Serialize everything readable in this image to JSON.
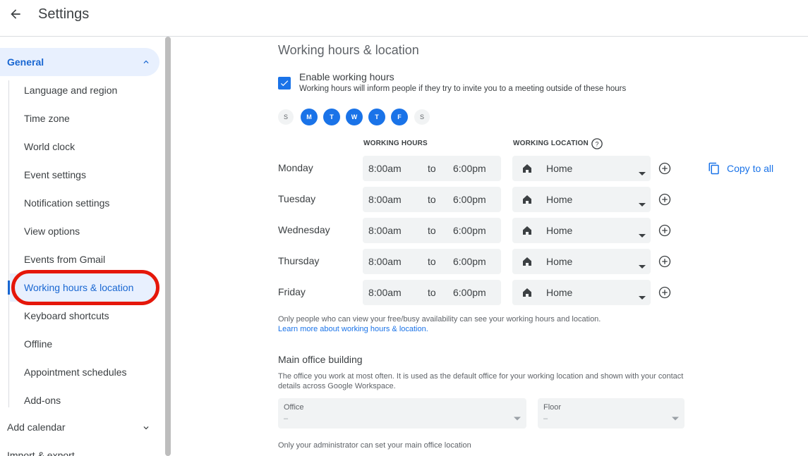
{
  "header": {
    "title": "Settings"
  },
  "sidebar": {
    "general_label": "General",
    "items": [
      {
        "label": "Language and region"
      },
      {
        "label": "Time zone"
      },
      {
        "label": "World clock"
      },
      {
        "label": "Event settings"
      },
      {
        "label": "Notification settings"
      },
      {
        "label": "View options"
      },
      {
        "label": "Events from Gmail"
      },
      {
        "label": "Working hours & location"
      },
      {
        "label": "Keyboard shortcuts"
      },
      {
        "label": "Offline"
      },
      {
        "label": "Appointment schedules"
      },
      {
        "label": "Add-ons"
      }
    ],
    "active_item": "Working hours & location",
    "add_calendar": "Add calendar",
    "import_export": "Import & export"
  },
  "main": {
    "title": "Working hours & location",
    "enable": {
      "label": "Enable working hours",
      "description": "Working hours will inform people if they try to invite you to a meeting outside of these hours",
      "checked": true
    },
    "days": [
      {
        "letter": "S",
        "on": false
      },
      {
        "letter": "M",
        "on": true
      },
      {
        "letter": "T",
        "on": true
      },
      {
        "letter": "W",
        "on": true
      },
      {
        "letter": "T",
        "on": true
      },
      {
        "letter": "F",
        "on": true
      },
      {
        "letter": "S",
        "on": false
      }
    ],
    "col_hours": "WORKING HOURS",
    "col_location": "WORKING LOCATION",
    "to_label": "to",
    "rows": [
      {
        "day": "Monday",
        "start": "8:00am",
        "end": "6:00pm",
        "location": "Home"
      },
      {
        "day": "Tuesday",
        "start": "8:00am",
        "end": "6:00pm",
        "location": "Home"
      },
      {
        "day": "Wednesday",
        "start": "8:00am",
        "end": "6:00pm",
        "location": "Home"
      },
      {
        "day": "Thursday",
        "start": "8:00am",
        "end": "6:00pm",
        "location": "Home"
      },
      {
        "day": "Friday",
        "start": "8:00am",
        "end": "6:00pm",
        "location": "Home"
      }
    ],
    "copy_all": "Copy to all",
    "note": "Only people who can view your free/busy availability can see your working hours and location.",
    "learn_more": "Learn more about working hours & location.",
    "main_office": {
      "title": "Main office building",
      "description": "The office you work at most often. It is used as the default office for your working location and shown with your contact details across Google Workspace.",
      "office_label": "Office",
      "office_value": "–",
      "floor_label": "Floor",
      "floor_value": "–",
      "admin_note": "Only your administrator can set your main office location"
    }
  },
  "colors": {
    "accent": "#1a73e8",
    "active_bg": "#e8f0fe",
    "highlight_ring": "#e5170a"
  }
}
